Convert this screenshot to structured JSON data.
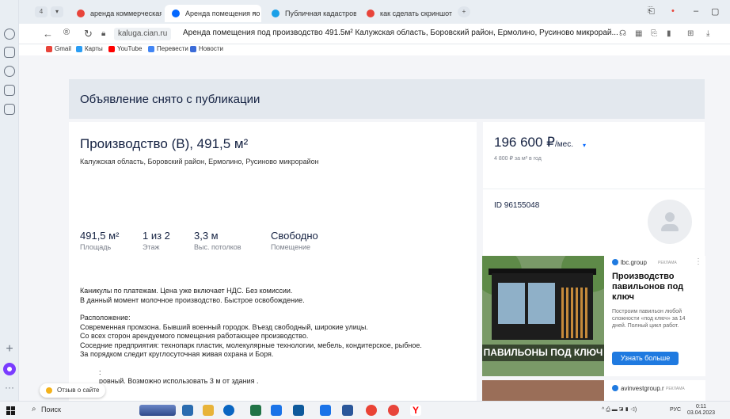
{
  "browser": {
    "tabs": [
      {
        "label": "аренда коммерческая не",
        "active": false,
        "color": "#e8443a"
      },
      {
        "label": "Аренда помещения по",
        "active": true,
        "color": "#0468ff"
      },
      {
        "label": "Публичная кадастровая",
        "active": false,
        "color": "#1aa0e8"
      },
      {
        "label": "как сделать скриншот на",
        "active": false,
        "color": "#e8443a"
      }
    ],
    "tab_close": "×",
    "new_tab": "+",
    "tab_counter": "4",
    "domain": "kaluga.cian.ru",
    "page_title": "Аренда помещения под производство 491.5м² Калужская область, Боровский район, Ермолино, Русиново микрорай...",
    "bookmarks": [
      {
        "label": "Gmail",
        "color": "#e8443a"
      },
      {
        "label": "Карты",
        "color": "#2a9df4"
      },
      {
        "label": "YouTube",
        "color": "#ff0000"
      },
      {
        "label": "Перевести",
        "color": "#4285f4"
      },
      {
        "label": "Новости",
        "color": "#3b6bd8"
      }
    ]
  },
  "notice": "Объявление снято с публикации",
  "listing": {
    "title": "Производство (B), 491,5 м²",
    "address": "Калужская область, Боровский район, Ермолино, Русиново микрорайон",
    "facts": [
      {
        "value": "491,5 м²",
        "label": "Площадь"
      },
      {
        "value": "1 из 2",
        "label": "Этаж"
      },
      {
        "value": "3,3 м",
        "label": "Выс. потолков"
      },
      {
        "value": "Свободно",
        "label": "Помещение"
      }
    ],
    "description": [
      "Каникулы по платежам. Цена уже включает НДС. Без комиссии.",
      "В данный момент молочное производство. Быстрое освобождение.",
      "",
      "Расположение:",
      "Современная промзона. Бывший военный городок. Въезд свободный, широкие улицы.",
      "Со всех сторон арендуемого помещения работающее производство.",
      "Соседние предприятия: технопарк  пластик, молекулярные технологии, мебель, кондитерское, рыбное.",
      "За порядком следит круглосуточная живая охрана и Боря.",
      "",
      ":",
      "ровный. Возможно использовать 3 м от здания ."
    ]
  },
  "price": {
    "amount": "196 600 ₽",
    "unit": "/мес.",
    "per_meter": "4 800 ₽ за м² в год"
  },
  "ad_id": "ID 96155048",
  "ad": {
    "source": "lbc.group",
    "label": "РЕКЛАМА",
    "image_text": "ПАВИЛЬОНЫ ПОД КЛЮЧ",
    "headline": "Производство павильонов под ключ",
    "body": "Построим павильон любой сложности «под ключ» за 14 дней. Полный цикл работ.",
    "button": "Узнать больше",
    "menu": "⋮"
  },
  "ad2": {
    "source": "avinvestgroup.r",
    "label": "РЕКЛАМА"
  },
  "review_button": "Отзыв о сайте",
  "taskbar": {
    "search": "Поиск",
    "lang": "РУС",
    "time": "0:11",
    "date": "03.04.2023",
    "apps": [
      "#2b6cb0",
      "#1e7e34",
      "#0a66c2",
      "#1e7e34",
      "#217346",
      "#1a73e8",
      "#0e5a9c",
      "#2b579a",
      "#ea4335",
      "#e8443a",
      "#ff0000"
    ]
  }
}
